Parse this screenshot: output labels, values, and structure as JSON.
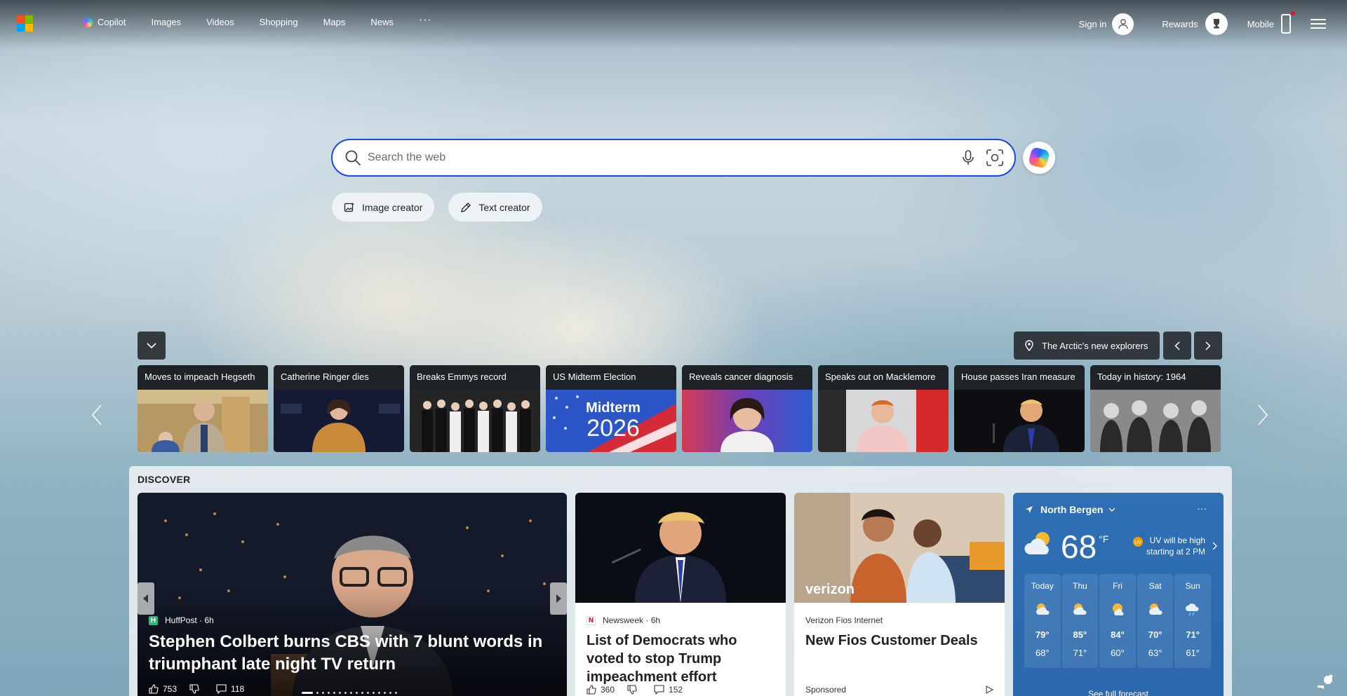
{
  "nav": {
    "items": [
      "Copilot",
      "Images",
      "Videos",
      "Shopping",
      "Maps",
      "News"
    ],
    "more": "···"
  },
  "header": {
    "sign_in": "Sign in",
    "rewards": "Rewards",
    "mobile": "Mobile"
  },
  "search": {
    "placeholder": "Search the web"
  },
  "chips": [
    "Image creator",
    "Text creator"
  ],
  "image_caption": "The Arctic's new explorers",
  "trending": [
    "Moves to impeach Hegseth",
    "Catherine Ringer dies",
    "Breaks Emmys record",
    "US Midterm Election",
    "Reveals cancer diagnosis",
    "Speaks out on Macklemore",
    "House passes Iran measure",
    "Today in history: 1964"
  ],
  "trending_image_text": {
    "midterm_line1": "Midterm",
    "midterm_line2": "2026"
  },
  "discover": {
    "heading": "DISCOVER",
    "big": {
      "source": "HuffPost",
      "age": "6h",
      "title": "Stephen Colbert burns CBS with 7 blunt words in triumphant late night TV return",
      "likes": "753",
      "comments": "118"
    },
    "card2": {
      "source": "Newsweek",
      "age": "6h",
      "title": "List of Democrats who voted to stop Trump impeachment effort",
      "likes": "360",
      "comments": "152"
    },
    "card3": {
      "source": "Verizon Fios Internet",
      "title": "New Fios Customer Deals",
      "sponsored": "Sponsored",
      "brand": "verizon"
    }
  },
  "weather": {
    "location": "North Bergen",
    "more": "···",
    "temp": "68",
    "unit": "°F",
    "uv_line1": "UV will be high",
    "uv_line2": "starting at 2 PM",
    "days": [
      {
        "name": "Today",
        "hi": "79°",
        "lo": "68°"
      },
      {
        "name": "Thu",
        "hi": "85°",
        "lo": "71°"
      },
      {
        "name": "Fri",
        "hi": "84°",
        "lo": "60°"
      },
      {
        "name": "Sat",
        "hi": "70°",
        "lo": "63°"
      },
      {
        "name": "Sun",
        "hi": "71°",
        "lo": "61°"
      }
    ],
    "full_link": "See full forecast"
  },
  "colors": {
    "accent": "#174ae4",
    "weather_bg": "#2f6fb4"
  }
}
